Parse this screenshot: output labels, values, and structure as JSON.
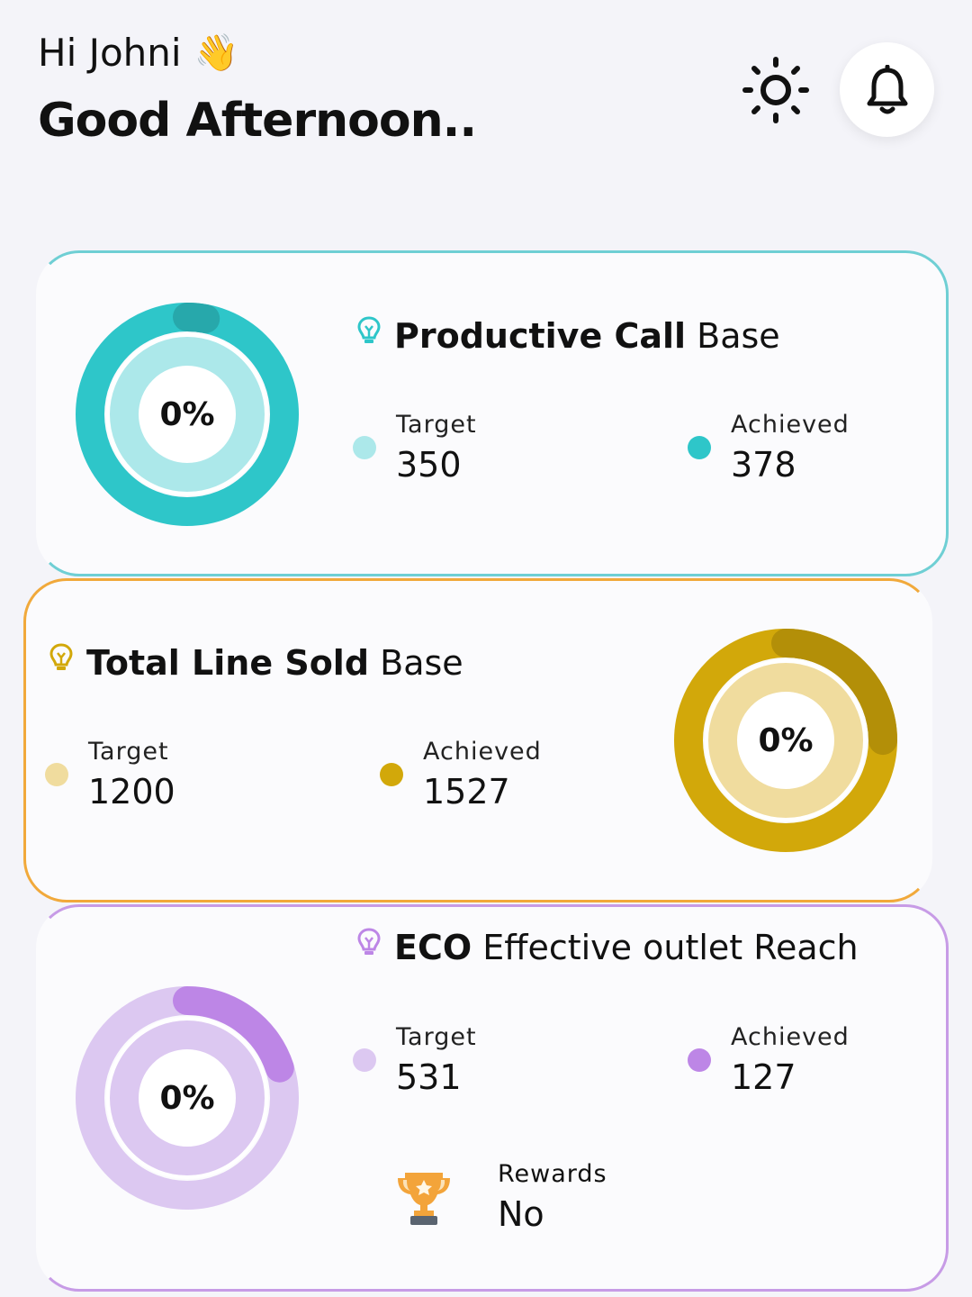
{
  "header": {
    "greeting": "Hi Johni",
    "wave_emoji": "👋",
    "subtitle": "Good Afternoon..",
    "icons": [
      "sun-icon",
      "bell-icon"
    ]
  },
  "cards": [
    {
      "title_bold": "Productive Call",
      "title_rest": "Base",
      "percent_label": "0%",
      "target_label": "Target",
      "target_value": "350",
      "achieved_label": "Achieved",
      "achieved_value": "378",
      "color_main": "#2ec6c9",
      "color_light": "#ace8ea",
      "progress_fraction": 0.03
    },
    {
      "title_bold": "Total Line Sold",
      "title_rest": "Base",
      "percent_label": "0%",
      "target_label": "Target",
      "target_value": "1200",
      "achieved_label": "Achieved",
      "achieved_value": "1527",
      "color_main": "#d2a80a",
      "color_light": "#f0dc9e",
      "progress_fraction": 0.25
    },
    {
      "title_bold": "ECO",
      "title_rest": "Effective outlet Reach",
      "percent_label": "0%",
      "target_label": "Target",
      "target_value": "531",
      "achieved_label": "Achieved",
      "achieved_value": "127",
      "color_main": "#bd86e6",
      "color_light": "#dcc8f1",
      "progress_fraction": 0.2,
      "rewards_label": "Rewards",
      "rewards_value": "No"
    }
  ]
}
